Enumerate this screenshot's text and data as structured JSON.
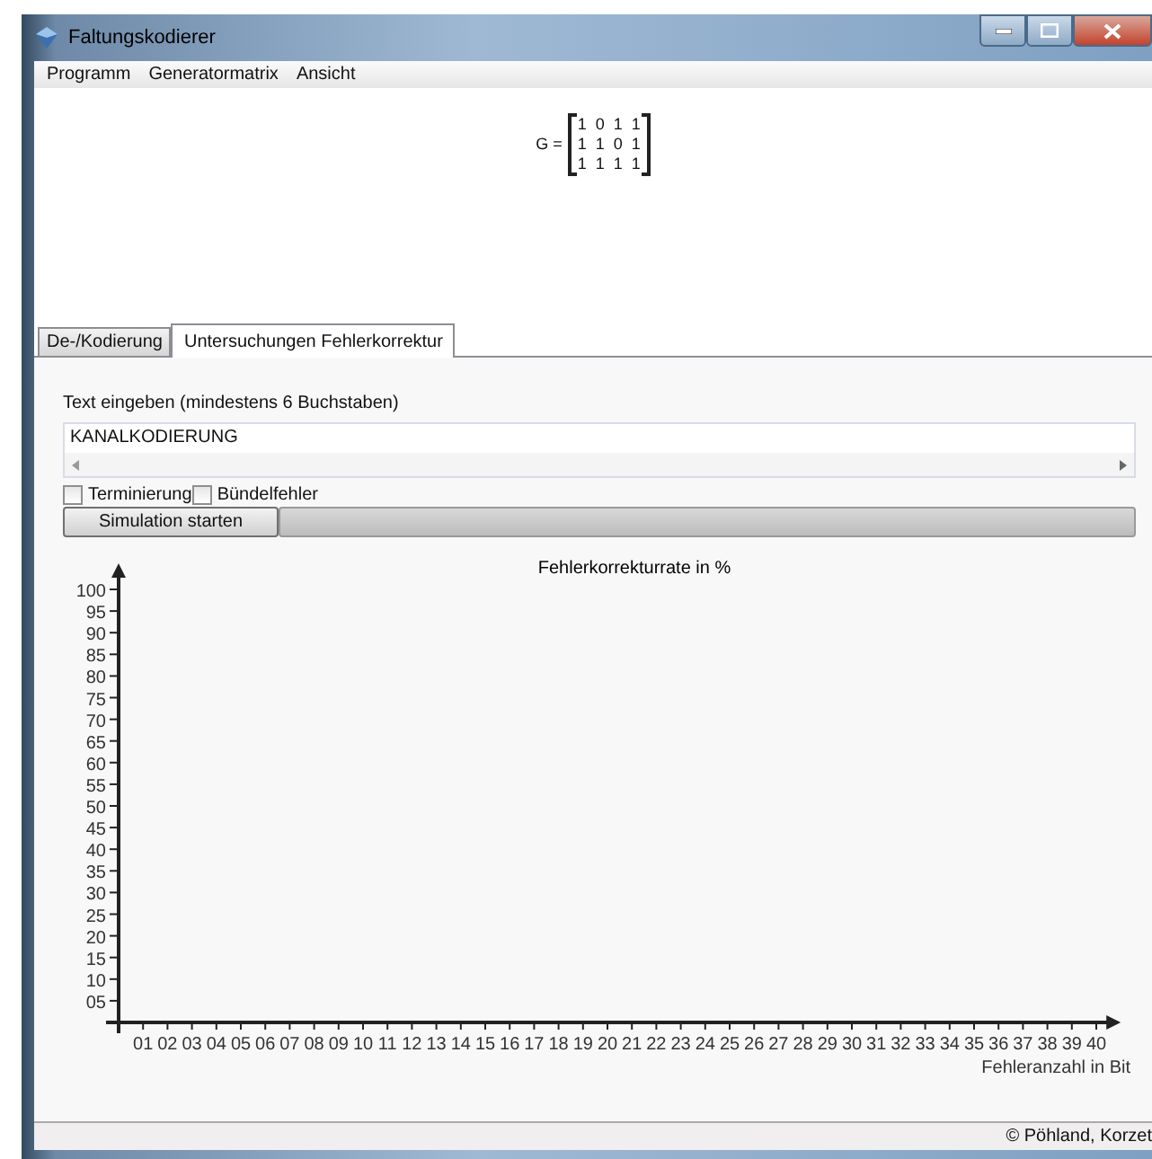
{
  "window": {
    "title": "Faltungskodierer"
  },
  "menu": [
    "Programm",
    "Generatormatrix",
    "Ansicht"
  ],
  "matrix": {
    "label": "G =",
    "rows": [
      [
        "1",
        "0",
        "1",
        "1"
      ],
      [
        "1",
        "1",
        "0",
        "1"
      ],
      [
        "1",
        "1",
        "1",
        "1"
      ]
    ]
  },
  "tabs": [
    {
      "label": "De-/Kodierung",
      "selected": false
    },
    {
      "label": "Untersuchungen Fehlerkorrektur",
      "selected": true
    }
  ],
  "input": {
    "label": "Text eingeben (mindestens 6 Buchstaben)",
    "value": "KANALKODIERUNG"
  },
  "options": [
    {
      "label": "Terminierung",
      "checked": false
    },
    {
      "label": "Bündelfehler",
      "checked": false
    }
  ],
  "simulate_button": "Simulation starten",
  "progress": {
    "level": 0
  },
  "chart": {
    "chart_data": {
      "type": "line",
      "title": "Fehlerkorrekturrate in %",
      "xlabel": "Fehleranzahl in Bit",
      "xlim": [
        0,
        41
      ],
      "ylim": [
        0,
        106
      ],
      "xticks": [
        {
          "value": 1,
          "label": "01"
        },
        {
          "value": 2,
          "label": "02"
        },
        {
          "value": 3,
          "label": "03"
        },
        {
          "value": 4,
          "label": "04"
        },
        {
          "value": 5,
          "label": "05"
        },
        {
          "value": 6,
          "label": "06"
        },
        {
          "value": 7,
          "label": "07"
        },
        {
          "value": 8,
          "label": "08"
        },
        {
          "value": 9,
          "label": "09"
        },
        10,
        11,
        12,
        13,
        14,
        15,
        16,
        17,
        18,
        19,
        20,
        21,
        22,
        23,
        24,
        25,
        26,
        27,
        28,
        29,
        30,
        31,
        32,
        33,
        34,
        35,
        36,
        37,
        38,
        39,
        40
      ],
      "yticks": [
        {
          "value": 5,
          "label": "05"
        },
        10,
        15,
        20,
        25,
        30,
        35,
        40,
        45,
        50,
        55,
        60,
        65,
        70,
        75,
        80,
        85,
        90,
        95,
        100
      ]
    }
  },
  "status_bar": "© Pöhland, Korzet"
}
